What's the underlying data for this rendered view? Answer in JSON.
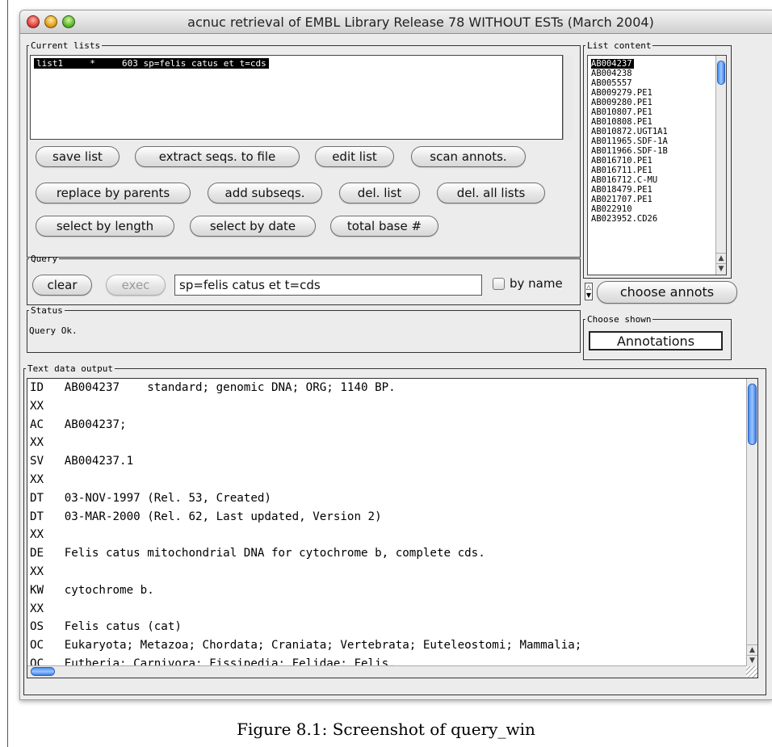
{
  "window": {
    "title": "acnuc retrieval of EMBL Library Release 78 WITHOUT ESTs  (March 2004)"
  },
  "current_lists": {
    "legend": "Current lists",
    "selected_row": "list1     *     603 sp=felis catus et t=cds",
    "buttons": {
      "save_list": "save list",
      "extract": "extract seqs. to file",
      "edit_list": "edit list",
      "scan_annots": "scan annots.",
      "replace_parents": "replace by parents",
      "add_subseqs": "add subseqs.",
      "del_list": "del. list",
      "del_all": "del. all lists",
      "select_length": "select by length",
      "select_date": "select by date",
      "total_base": "total base #"
    }
  },
  "list_content": {
    "legend": "List content",
    "items": [
      "AB004237",
      "AB004238",
      "AB005557",
      "AB009279.PE1",
      "AB009280.PE1",
      "AB010807.PE1",
      "AB010808.PE1",
      "AB010872.UGT1A1",
      "AB011965.SDF-1A",
      "AB011966.SDF-1B",
      "AB016710.PE1",
      "AB016711.PE1",
      "AB016712.C-MU",
      "AB018479.PE1",
      "AB021707.PE1",
      "AB022910",
      "AB023952.CD26"
    ],
    "choose_annots": "choose annots"
  },
  "query": {
    "legend": "Query",
    "clear": "clear",
    "exec": "exec",
    "value": "sp=felis catus et t=cds",
    "by_name": "by name"
  },
  "status": {
    "legend": "Status",
    "text": "Query Ok."
  },
  "choose_shown": {
    "legend": "Choose shown",
    "value": "Annotations"
  },
  "text_output": {
    "legend": "Text data output",
    "lines": [
      "ID   AB004237    standard; genomic DNA; ORG; 1140 BP.",
      "XX",
      "AC   AB004237;",
      "XX",
      "SV   AB004237.1",
      "XX",
      "DT   03-NOV-1997 (Rel. 53, Created)",
      "DT   03-MAR-2000 (Rel. 62, Last updated, Version 2)",
      "XX",
      "DE   Felis catus mitochondrial DNA for cytochrome b, complete cds.",
      "XX",
      "KW   cytochrome b.",
      "XX",
      "OS   Felis catus (cat)",
      "OC   Eukaryota; Metazoa; Chordata; Craniata; Vertebrata; Euteleostomi; Mammalia;",
      "OC   Eutheria; Carnivora; Fissipedia; Felidae; Felis."
    ]
  },
  "caption": "Figure 8.1: Screenshot of query_win"
}
